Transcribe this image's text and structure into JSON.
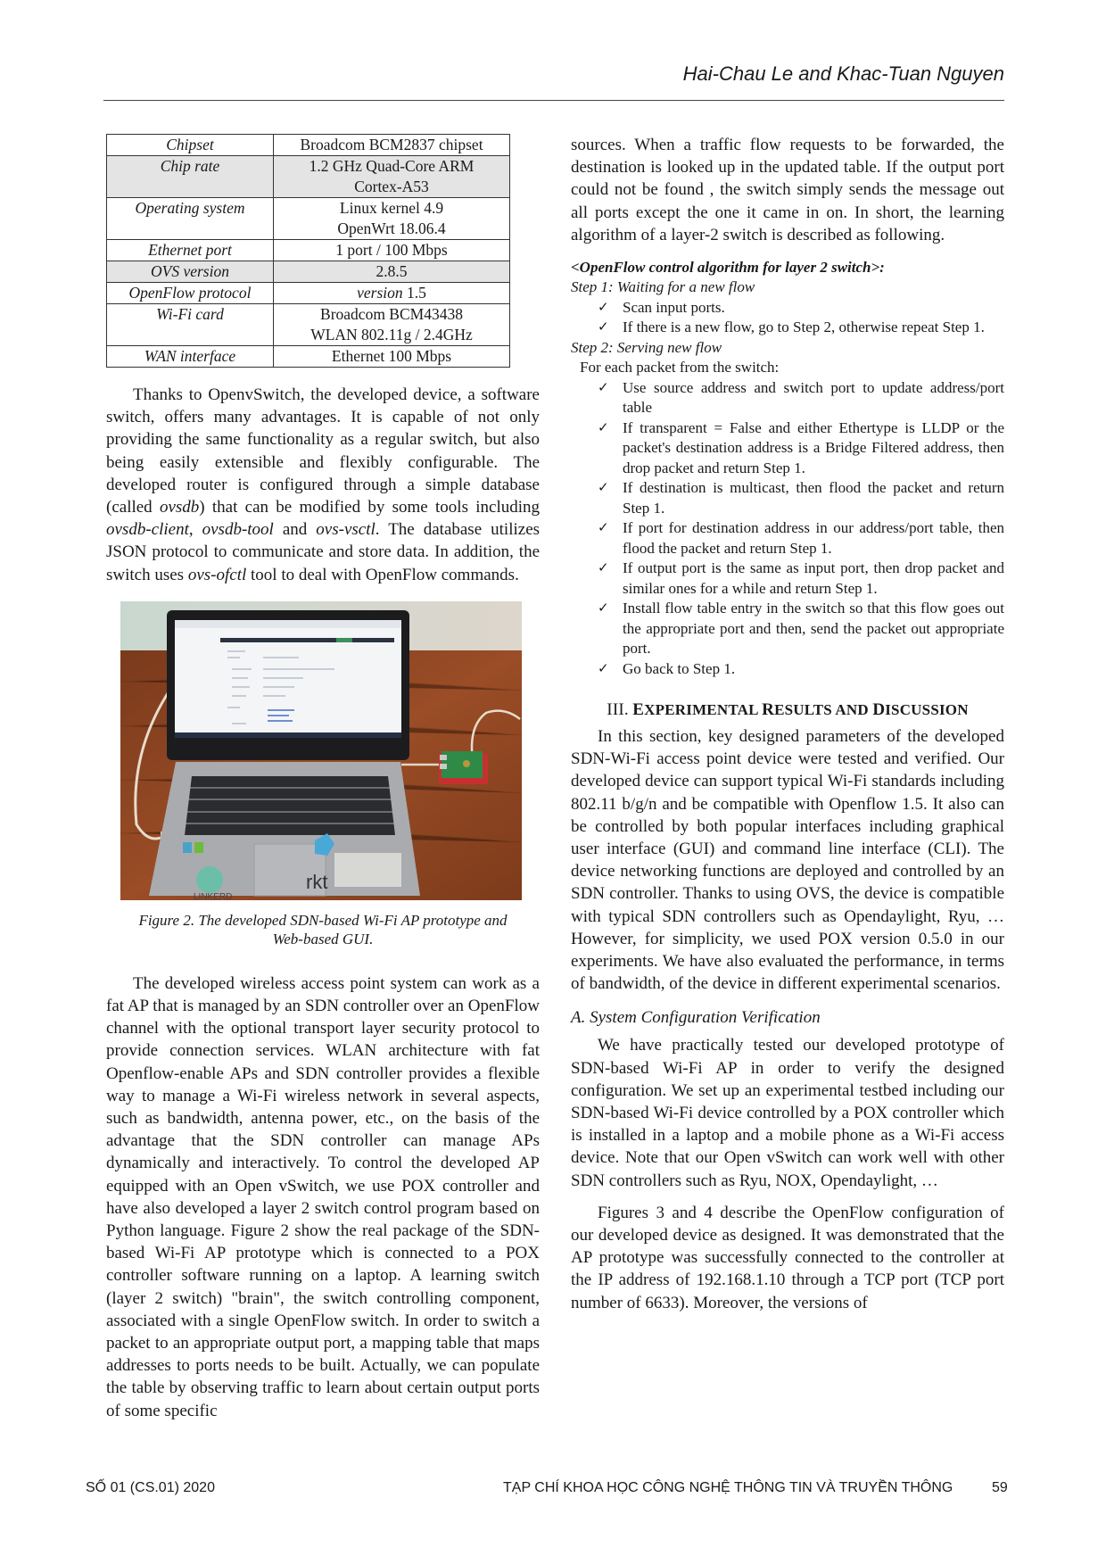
{
  "header": {
    "authors": "Hai-Chau Le and Khac-Tuan Nguyen"
  },
  "spec_table": {
    "rows": [
      {
        "key": "Chipset",
        "value": [
          "Broadcom BCM2837 chipset"
        ],
        "shaded": false
      },
      {
        "key": "Chip rate",
        "value": [
          "1.2 GHz Quad-Core ARM",
          "Cortex-A53"
        ],
        "shaded": true
      },
      {
        "key": "Operating system",
        "value": [
          "Linux kernel 4.9",
          "OpenWrt 18.06.4"
        ],
        "shaded": false
      },
      {
        "key": "Ethernet port",
        "value": [
          "1 port / 100 Mbps"
        ],
        "shaded": false
      },
      {
        "key": "OVS version",
        "value": [
          "2.8.5"
        ],
        "shaded": true
      },
      {
        "key": "OpenFlow protocol",
        "value_italic": "version",
        "value": [
          " 1.5"
        ],
        "shaded": false
      },
      {
        "key": "Wi-Fi card",
        "value": [
          "Broadcom BCM43438",
          "WLAN 802.11g / 2.4GHz"
        ],
        "shaded": false
      },
      {
        "key": "WAN interface",
        "value": [
          "Ethernet 100 Mbps"
        ],
        "shaded": false
      }
    ]
  },
  "left_column": {
    "para_ovs": {
      "t1": "Thanks to OpenvSwitch, the developed device, a software switch, offers many advantages. It is capable of not only providing the same functionality as a regular switch, but also being easily extensible and flexibly configurable. The developed router is configured through a simple database (called ",
      "i1": "ovsdb",
      "t2": ") that can be modified by some tools including ",
      "i2": "ovsdb-client",
      "t3": ", ",
      "i3": "ovsdb-tool",
      "t4": " and ",
      "i4": "ovs-vsctl",
      "t5": ". The database utilizes JSON protocol to communicate and store data. In addition, the switch uses ",
      "i5": "ovs-ofctl",
      "t6": " tool to deal with OpenFlow commands."
    },
    "figure": {
      "stickers": [
        "rkt",
        "LINKERD"
      ],
      "caption_line1": "Figure 2. The developed SDN-based Wi-Fi AP prototype and",
      "caption_line2": "Web-based GUI."
    },
    "para_ap": "The developed wireless access point system can work as a fat AP that is managed by an SDN controller over an OpenFlow channel with the optional transport layer security protocol to provide connection services. WLAN architecture with fat Openflow-enable APs and SDN controller provides a flexible way to manage a Wi-Fi wireless network in several aspects, such as bandwidth, antenna power, etc., on the basis of the advantage that the SDN controller can manage APs dynamically and interactively. To control the developed AP equipped with an Open vSwitch, we use POX controller and have also developed a layer 2 switch control program based on Python language. Figure 2 show the real package of the SDN-based Wi-Fi AP prototype which is connected to a POX controller software running on a laptop. A learning switch (layer 2 switch) \"brain\", the switch controlling component, associated with a single OpenFlow switch. In order to switch a packet to an appropriate output port, a mapping table that maps addresses to ports needs to be built. Actually, we can populate the table by observing traffic to learn about certain output ports of some specific"
  },
  "right_column": {
    "para_cont": "sources. When a traffic flow requests to be forwarded, the destination is looked up in the updated table. If the output port could not be found , the switch simply sends the message out all ports except the one it came in on. In short, the learning algorithm of a layer-2 switch is described as following.",
    "algo_title": "<OpenFlow control algorithm for layer 2 switch>:",
    "step1_title": "Step 1: Waiting for a new flow",
    "step1_items": [
      "Scan input ports.",
      "If there is a new flow, go to Step 2, otherwise repeat Step 1."
    ],
    "step2_title": "Step 2: Serving new flow",
    "step2_intro": "For each packet from the switch:",
    "step2_items": [
      "Use source address and switch port to update address/port table",
      "If transparent = False and either Ethertype is LLDP or the packet's destination address is a Bridge Filtered address, then drop packet and return Step 1.",
      "If destination is multicast, then flood the packet and return Step 1.",
      "If port for destination address in our address/port table, then flood the packet and return Step 1.",
      "If output port is the same as input port, then drop packet and similar ones for a while and return Step 1.",
      "Install flow table entry in the switch so that this flow goes out the appropriate port and then, send the packet out appropriate port.",
      "Go back to Step 1."
    ],
    "check_glyph": "✓",
    "section3": {
      "numeral": "III.",
      "words": [
        {
          "cap": "E",
          "rest": "XPERIMENTAL"
        },
        {
          "cap": "R",
          "rest": "ESULTS"
        },
        {
          "cap": "",
          "rest": "AND"
        },
        {
          "cap": "D",
          "rest": "ISCUSSION"
        }
      ]
    },
    "para_sec3": "In this section, key designed parameters of the developed SDN-Wi-Fi access point device were tested and verified. Our developed device can support typical Wi-Fi standards including 802.11 b/g/n and be compatible with Openflow 1.5. It also can be controlled by both popular interfaces including graphical user interface (GUI) and command line interface (CLI). The device networking functions are deployed and controlled by an SDN controller. Thanks to using OVS, the device is compatible with typical SDN controllers such as Opendaylight, Ryu, … However, for simplicity, we used POX version 0.5.0 in our experiments. We have also evaluated the performance, in terms of bandwidth, of the device in different experimental scenarios.",
    "subsection_a": "A.  System Configuration Verification",
    "para_verif": "We have practically tested our developed prototype of SDN-based Wi-Fi AP in order to verify the designed configuration. We set up an experimental testbed including our SDN-based Wi-Fi device controlled by a POX controller which is installed in a laptop and a mobile phone as a Wi-Fi access device. Note that our Open vSwitch can work well with other SDN controllers such as Ryu, NOX, Opendaylight, …",
    "para_fig34": "Figures 3 and 4 describe the OpenFlow configuration of our developed device as designed. It was demonstrated that the AP prototype was successfully connected to the controller at the IP address of 192.168.1.10 through a TCP port (TCP port number of 6633). Moreover, the versions of"
  },
  "footer": {
    "issue": "SỐ 01 (CS.01) 2020",
    "journal": "TẠP CHÍ KHOA HỌC CÔNG NGHỆ THÔNG TIN VÀ TRUYỀN THÔNG",
    "page": "59"
  }
}
